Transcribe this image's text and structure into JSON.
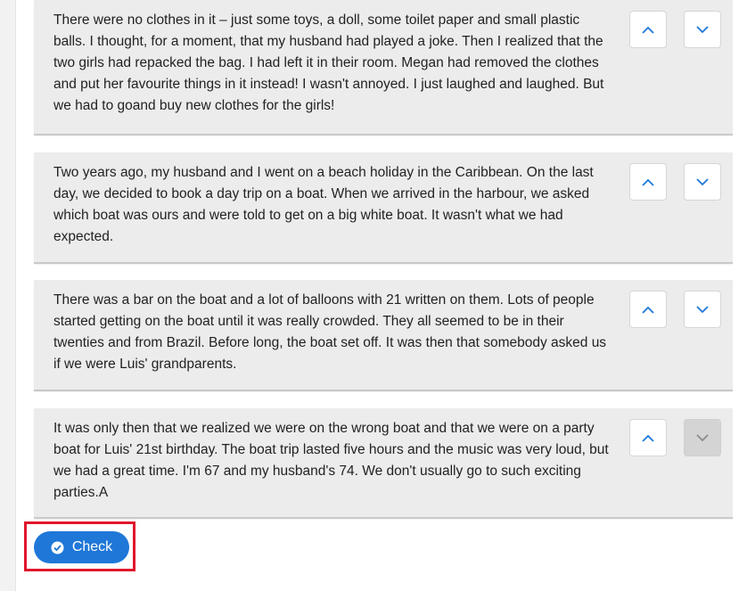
{
  "paragraphs": [
    {
      "text": "There were no clothes in it – just some toys, a doll, some toilet paper and small plastic balls. I thought, for a moment, that my husband had played a joke. Then I realized that the two girls had repacked the bag. I had left it in their room. Megan had removed the clothes and put her favourite things in it instead! I wasn't annoyed. I just laughed and laughed. But we had to goand buy new clothes for the girls!",
      "up_icon": "chevron-up-icon",
      "down_icon": "chevron-down-icon",
      "down_disabled": false
    },
    {
      "text": "Two years ago, my husband and I went on a beach holiday in the Caribbean. On the last day, we decided to book a day trip on a boat. When we arrived in the harbour, we asked which boat was ours and were told to get on a big white boat. It wasn't what we had expected.",
      "up_icon": "chevron-up-icon",
      "down_icon": "chevron-down-icon",
      "down_disabled": false
    },
    {
      "text": "There was a bar on the boat and a lot of balloons with 21 written on them. Lots of people started getting on the boat until it was really crowded. They all seemed to be in their twenties and from Brazil. Before long, the boat set off. It was then that somebody asked us if we were Luis' grandparents.",
      "up_icon": "chevron-up-icon",
      "down_icon": "chevron-down-icon",
      "down_disabled": false
    },
    {
      "text": "It was only then that we realized we were on the wrong boat and that we were on a party boat for Luis' 21st birthday. The boat trip lasted five hours and the music was very loud, but we had a great time. I'm 67 and my husband's 74. We don't usually go to such exciting parties.A",
      "up_icon": "chevron-up-icon",
      "down_icon": "chevron-down-icon",
      "down_disabled": true
    }
  ],
  "check_button": {
    "label": "Check",
    "icon": "check-circle-icon"
  },
  "colors": {
    "card_background": "#ececec",
    "button_blue": "#1f77d8",
    "highlight_red": "#e0162b",
    "chevron_blue": "#1f77d8",
    "disabled_gray": "#d4d4d4"
  }
}
